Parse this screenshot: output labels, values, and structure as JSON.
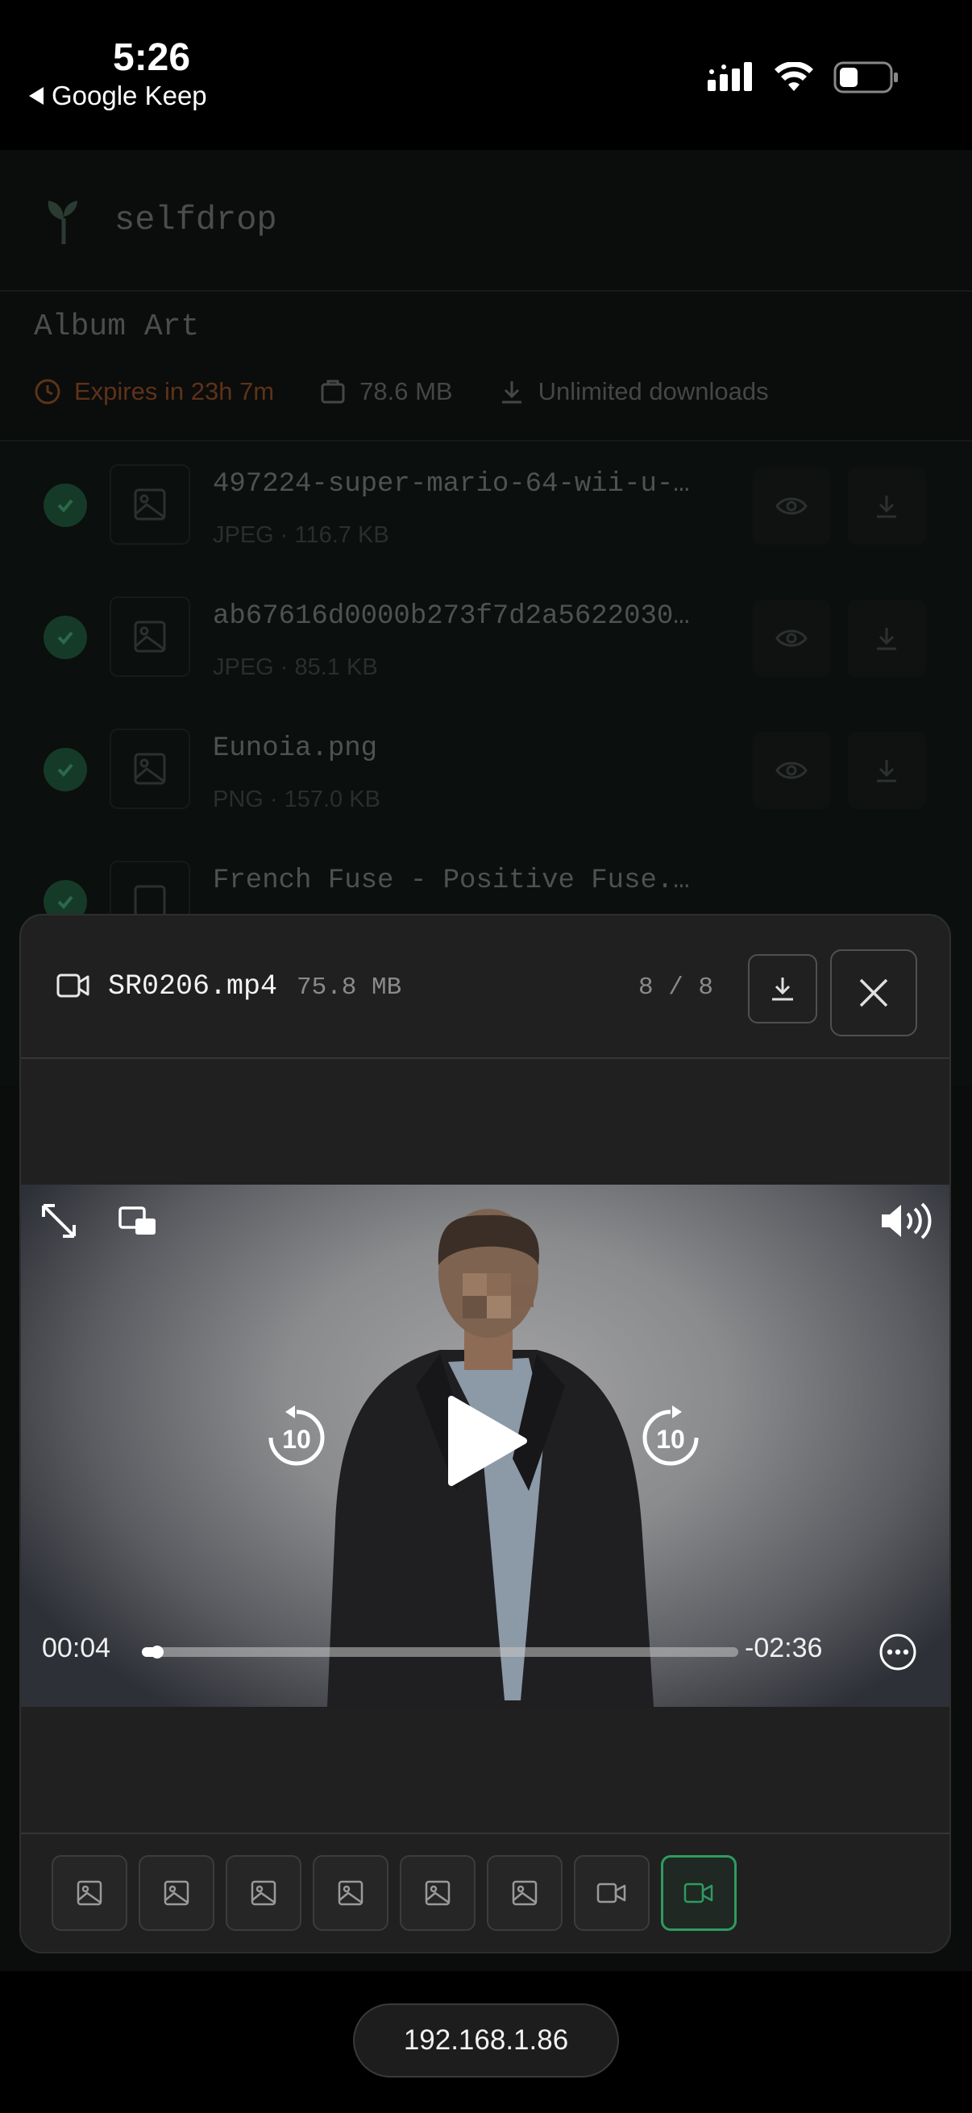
{
  "status_bar": {
    "time": "5:26",
    "back_label": "Google Keep",
    "icons": [
      "cellular-signal-icon",
      "wifi-icon",
      "battery-icon"
    ]
  },
  "app": {
    "name": "selfdrop",
    "drop_title": "Album Art",
    "expires": "Expires in 23h 7m",
    "total_size": "78.6 MB",
    "downloads": "Unlimited downloads",
    "files": [
      {
        "name": "497224-super-mario-64-wii-u-…",
        "sub": "JPEG · 116.7 KB"
      },
      {
        "name": "ab67616d0000b273f7d2a5622030…",
        "sub": "JPEG · 85.1 KB"
      },
      {
        "name": "Eunoia.png",
        "sub": "PNG · 157.0 KB"
      },
      {
        "name": "French Fuse - Positive Fuse.…",
        "sub": ""
      }
    ]
  },
  "viewer": {
    "file_name": "SR0206.mp4",
    "file_size": "75.8 MB",
    "position": "8 / 8",
    "video": {
      "current_time": "00:04",
      "remaining_time": "-02:36",
      "progress_fraction": 0.026,
      "skip_back_label": "10",
      "skip_forward_label": "10"
    },
    "thumbnails": [
      {
        "type": "image",
        "active": false
      },
      {
        "type": "image",
        "active": false
      },
      {
        "type": "image",
        "active": false
      },
      {
        "type": "image",
        "active": false
      },
      {
        "type": "image",
        "active": false
      },
      {
        "type": "image",
        "active": false
      },
      {
        "type": "video",
        "active": false
      },
      {
        "type": "video",
        "active": true
      }
    ]
  },
  "host": "192.168.1.86",
  "colors": {
    "accent_green": "#2f9a60",
    "expiry_orange": "#5d3318",
    "modal_bg": "#202020"
  }
}
